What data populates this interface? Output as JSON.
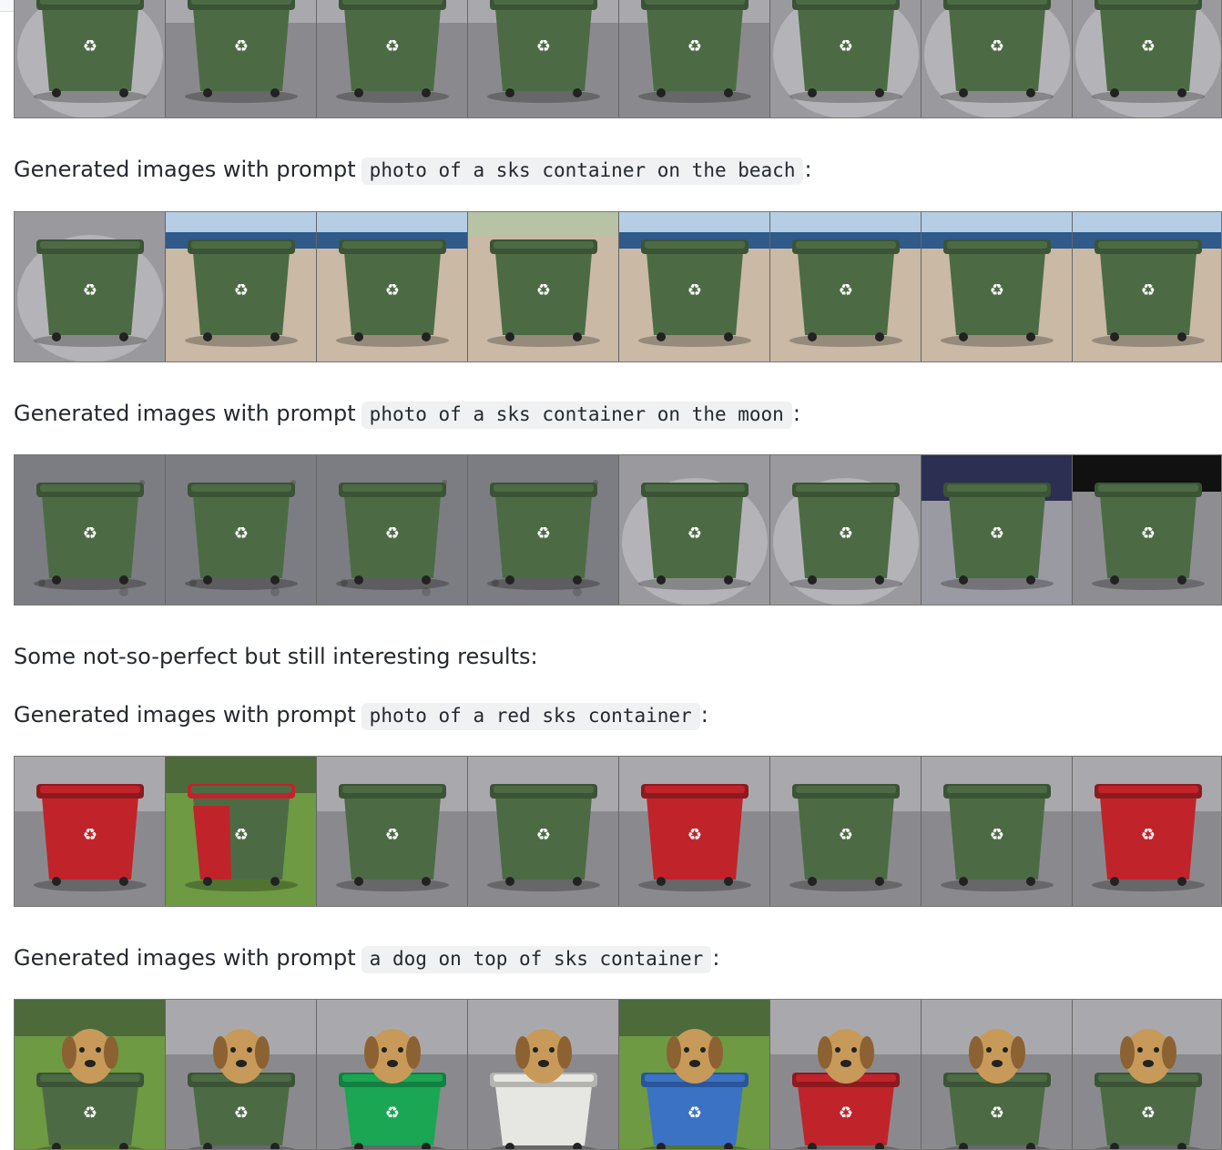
{
  "text": {
    "prefix": "Generated images with prompt",
    "colon": ":",
    "note": "Some not-so-perfect but still interesting results:"
  },
  "prompts": {
    "beach": "photo of a sks container on the beach",
    "moon": "photo of a sks container on the moon",
    "red": "photo of a red sks container",
    "dog": "a dog on top of sks container"
  },
  "colors": {
    "bin_green": "#4c6b45",
    "bin_green_dark": "#3a5435",
    "bin_red": "#c0242a",
    "bin_blue": "#3b72c4",
    "bright_green": "#1aa653",
    "sand": "#c9b9a5",
    "sea": "#2f5a8a",
    "moon_ground": "#7c7d82",
    "pavement": "#8a8a8e",
    "grass": "#6d9a42"
  },
  "strips": [
    {
      "id": "studio",
      "tiles": [
        {
          "bg": "studio",
          "bin": "green"
        },
        {
          "bg": "pavement",
          "bin": "green"
        },
        {
          "bg": "pavement",
          "bin": "green"
        },
        {
          "bg": "pavement",
          "bin": "green"
        },
        {
          "bg": "pavement",
          "bin": "green"
        },
        {
          "bg": "studio",
          "bin": "green"
        },
        {
          "bg": "studio",
          "bin": "green"
        },
        {
          "bg": "studio",
          "bin": "green"
        }
      ]
    },
    {
      "id": "beach",
      "tiles": [
        {
          "bg": "studio",
          "bin": "green"
        },
        {
          "bg": "beach",
          "bin": "green"
        },
        {
          "bg": "beach",
          "bin": "green"
        },
        {
          "bg": "sand",
          "bin": "green"
        },
        {
          "bg": "beach",
          "bin": "green"
        },
        {
          "bg": "beach",
          "bin": "green"
        },
        {
          "bg": "beach",
          "bin": "green"
        },
        {
          "bg": "beach",
          "bin": "green"
        }
      ]
    },
    {
      "id": "moon",
      "tiles": [
        {
          "bg": "moon",
          "bin": "green"
        },
        {
          "bg": "moon",
          "bin": "green"
        },
        {
          "bg": "moon",
          "bin": "green"
        },
        {
          "bg": "moon",
          "bin": "green"
        },
        {
          "bg": "studio",
          "bin": "green"
        },
        {
          "bg": "studio",
          "bin": "green"
        },
        {
          "bg": "moon_sky",
          "bin": "green"
        },
        {
          "bg": "moon_dark",
          "bin": "green"
        }
      ]
    },
    {
      "id": "red",
      "tiles": [
        {
          "bg": "pavement",
          "bin": "red"
        },
        {
          "bg": "grass",
          "bin": "greenred"
        },
        {
          "bg": "pavement",
          "bin": "green"
        },
        {
          "bg": "pavement",
          "bin": "green"
        },
        {
          "bg": "pavement",
          "bin": "red"
        },
        {
          "bg": "pavement",
          "bin": "green"
        },
        {
          "bg": "pavement",
          "bin": "green"
        },
        {
          "bg": "pavement",
          "bin": "red"
        }
      ]
    },
    {
      "id": "dog",
      "tiles": [
        {
          "bg": "grass",
          "bin": "green",
          "dog": true
        },
        {
          "bg": "pavement",
          "bin": "green",
          "dog": true
        },
        {
          "bg": "pavement",
          "bin": "bright",
          "dog": true
        },
        {
          "bg": "pavement",
          "bin": "white",
          "dog": true
        },
        {
          "bg": "grass",
          "bin": "blue",
          "dog": true
        },
        {
          "bg": "pavement",
          "bin": "red",
          "dog": true
        },
        {
          "bg": "pavement",
          "bin": "green",
          "dog": true
        },
        {
          "bg": "pavement",
          "bin": "green",
          "dog": true
        }
      ]
    }
  ]
}
